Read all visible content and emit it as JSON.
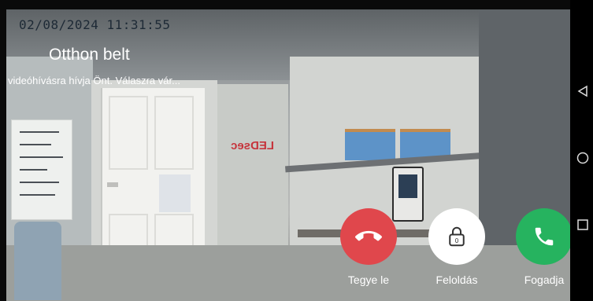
{
  "video": {
    "timestamp": "02/08/2024 11:31:55",
    "scene_text": "LEDsec"
  },
  "call": {
    "caller_name": "Otthon belt",
    "status": "videóhívásra hívja Önt. Válaszra vár..."
  },
  "actions": [
    {
      "label": "Tegye le",
      "icon": "hang-up-icon",
      "color": "#e0474c"
    },
    {
      "label": "Feloldás",
      "icon": "lock-icon",
      "color": "#ffffff"
    },
    {
      "label": "Fogadja",
      "icon": "phone-icon",
      "color": "#26b35f"
    }
  ],
  "nav": [
    {
      "icon": "back-icon"
    },
    {
      "icon": "home-icon"
    },
    {
      "icon": "recents-icon"
    }
  ]
}
